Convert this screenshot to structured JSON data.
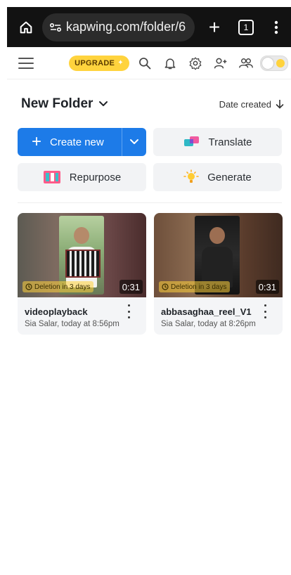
{
  "browser": {
    "url": "kapwing.com/folder/6",
    "tab_count": "1"
  },
  "toolbar": {
    "upgrade_label": "UPGRADE"
  },
  "folder": {
    "title": "New Folder",
    "sort_label": "Date created"
  },
  "actions": {
    "create_label": "Create new",
    "translate_label": "Translate",
    "repurpose_label": "Repurpose",
    "generate_label": "Generate"
  },
  "projects": [
    {
      "title": "videoplayback",
      "meta": "Sia Salar, today at 8:56pm",
      "duration": "0:31",
      "deletion": "Deletion in 3 days"
    },
    {
      "title": "abbasaghaa_reel_V1",
      "meta": "Sia Salar, today at 8:26pm",
      "duration": "0:31",
      "deletion": "Deletion in 3 days"
    }
  ],
  "colors": {
    "accent": "#1d7be8",
    "upgrade": "#ffd33d",
    "browser_bar": "#121212"
  }
}
